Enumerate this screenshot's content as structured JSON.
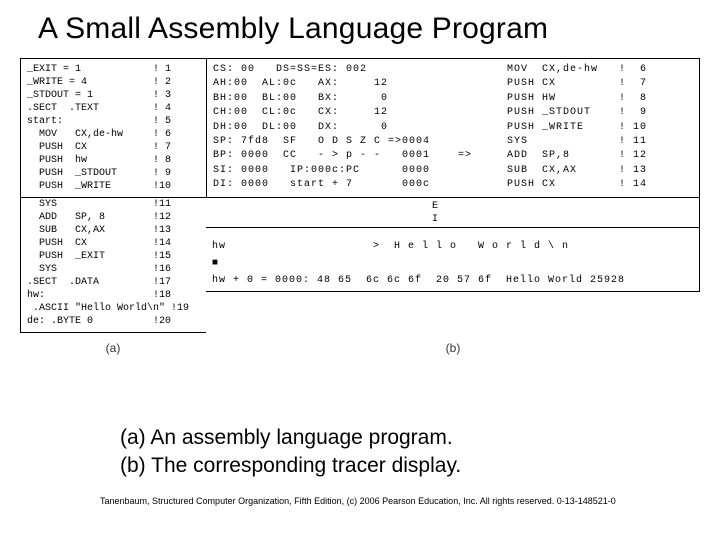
{
  "title": "A Small Assembly Language Program",
  "panelA_top": "_EXIT = 1            ! 1\n_WRITE = 4           ! 2\n_STDOUT = 1          ! 3\n.SECT  .TEXT         ! 4\nstart:               ! 5\n  MOV   CX,de-hw     ! 6\n  PUSH  CX           ! 7\n  PUSH  hw           ! 8\n  PUSH  _STDOUT      ! 9\n  PUSH  _WRITE       !10",
  "panelA_bot": "  SYS                !11\n  ADD   SP, 8        !12\n  SUB   CX,AX        !13\n  PUSH  CX           !14\n  PUSH  _EXIT        !15\n  SYS                !16\n.SECT  .DATA         !17\nhw:                  !18\n .ASCII \"Hello World\\n\" !19\nde: .BYTE 0          !20",
  "panelB_regs": "CS: 00   DS=SS=ES: 002                    MOV  CX,de-hw   !  6\nAH:00  AL:0c   AX:     12                 PUSH CX         !  7\nBH:00  BL:00   BX:      0                 PUSH HW         !  8\nCH:00  CL:0c   CX:     12                 PUSH _STDOUT    !  9\nDH:00  DL:00   DX:      0                 PUSH _WRITE     ! 10\nSP: 7fd8  SF   O D S Z C =>0004           SYS             ! 11\nBP: 0000  CC   - > p - -   0001    =>     ADD  SP,8       ! 12\nSI: 0000   IP:000c:PC      0000           SUB  CX,AX      ! 13\nDI: 0000   start + 7       000c           PUSH CX         ! 14",
  "panelB_ei": "E\nI",
  "panelB_hw": "hw                     >  H e l l o   W o r l d \\ n\n■\nhw + 0 = 0000: 48 65  6c 6c 6f  20 57 6f  Hello World 25928",
  "label_a": "(a)",
  "label_b": "(b)",
  "caption_a": "(a) An assembly language program.",
  "caption_b": "(b) The corresponding tracer display.",
  "credit": "Tanenbaum, Structured Computer Organization, Fifth Edition, (c) 2006 Pearson Education, Inc. All rights reserved. 0-13-148521-0"
}
